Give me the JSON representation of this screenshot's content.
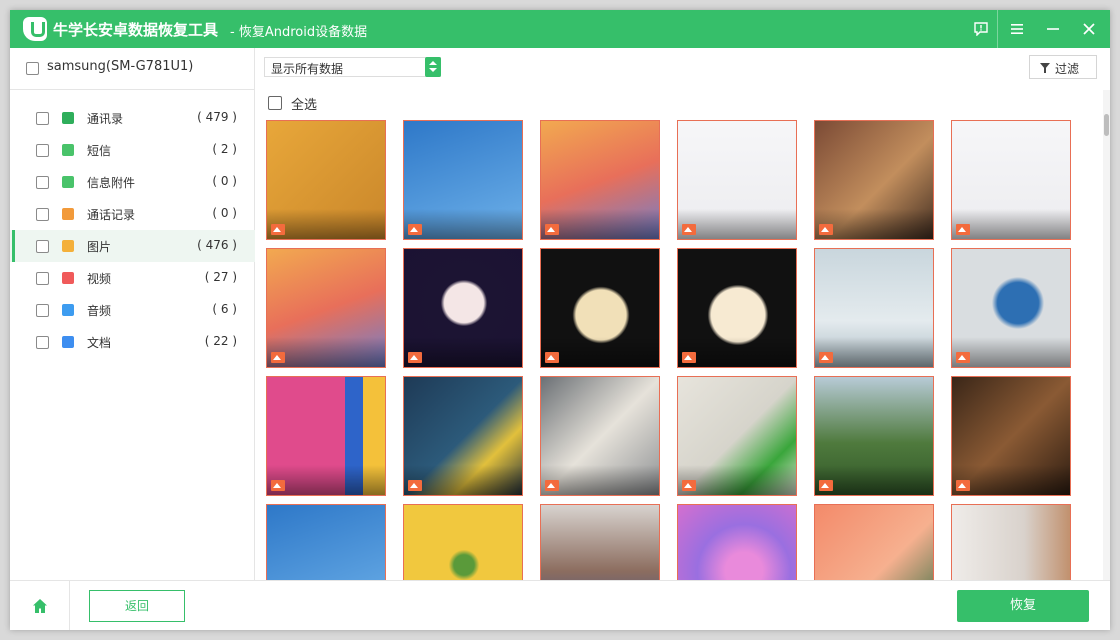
{
  "app": {
    "title": "牛学长安卓数据恢复工具",
    "subtitle": "- 恢复Android设备数据",
    "brand_color": "#36bf6a"
  },
  "titlebar_buttons": [
    {
      "name": "feedback-icon"
    },
    {
      "name": "menu-icon"
    },
    {
      "name": "minimize-icon"
    },
    {
      "name": "close-icon"
    }
  ],
  "device": {
    "name": "samsung(SM-G781U1)"
  },
  "categories": [
    {
      "label": "通讯录",
      "count": "( 479 )",
      "icon": "contacts-icon",
      "color": "#2fae5b"
    },
    {
      "label": "短信",
      "count": "( 2 )",
      "icon": "message-icon",
      "color": "#49c36a"
    },
    {
      "label": "信息附件",
      "count": "( 0 )",
      "icon": "attachment-icon",
      "color": "#49c36a"
    },
    {
      "label": "通话记录",
      "count": "( 0 )",
      "icon": "call-log-icon",
      "color": "#f29a3a"
    },
    {
      "label": "图片",
      "count": "( 476 )",
      "icon": "photo-icon",
      "color": "#f4b03a",
      "active": true
    },
    {
      "label": "视频",
      "count": "( 27 )",
      "icon": "video-icon",
      "color": "#f05a5a"
    },
    {
      "label": "音频",
      "count": "( 6 )",
      "icon": "audio-icon",
      "color": "#3d9cf0"
    },
    {
      "label": "文档",
      "count": "( 22 )",
      "icon": "document-icon",
      "color": "#3d8ef0"
    }
  ],
  "filter_select": {
    "value": "显示所有数据"
  },
  "filter_button": {
    "label": "过滤"
  },
  "select_all": {
    "label": "全选"
  },
  "thumbnails": [
    {
      "name": "thumb-dog-yellow",
      "bg": "linear-gradient(135deg,#e8a73a,#c9862a)"
    },
    {
      "name": "thumb-giraffe-blue",
      "bg": "linear-gradient(160deg,#2e78c8,#6fb2ea)"
    },
    {
      "name": "thumb-ios-homescreen",
      "bg": "linear-gradient(160deg,#f2a950,#e86f5a 50%,#6b7fd0)"
    },
    {
      "name": "thumb-notas-1",
      "bg": "linear-gradient(#f6f6f8,#ececef)"
    },
    {
      "name": "thumb-alpacas",
      "bg": "linear-gradient(135deg,#7b4a35,#c28e5d 55%,#3d2a1f)"
    },
    {
      "name": "thumb-notas-2",
      "bg": "linear-gradient(#f6f6f8,#ececef)"
    },
    {
      "name": "thumb-ios-homescreen-2",
      "bg": "linear-gradient(160deg,#f2a950,#e86f5a 50%,#6b7fd0)"
    },
    {
      "name": "thumb-coffee-laptop",
      "bg": "radial-gradient(circle at 50% 45%,#f4e6e6 22%,#1c1433 26%,#1b1233)"
    },
    {
      "name": "thumb-coffee-dizzy",
      "bg": "radial-gradient(circle at 50% 55%,#f1e0b8 28%,#111 32%)"
    },
    {
      "name": "thumb-coffee-smile",
      "bg": "radial-gradient(circle at 50% 55%,#f7ead2 30%,#111 34%)"
    },
    {
      "name": "thumb-desk-imac",
      "bg": "linear-gradient(#c9d6dd,#e4ebee 60%,#a8b9c2)"
    },
    {
      "name": "thumb-blue-cloth",
      "bg": "radial-gradient(circle at 55% 45%,#2d6fb3 22%,#d9dde0 28%)"
    },
    {
      "name": "thumb-pink-yellow",
      "bg": "linear-gradient(90deg,#e04b8c 65%,#2e64c9 65%,#2e64c9 80%,#f4c13a 80%)"
    },
    {
      "name": "thumb-banana-costumes",
      "bg": "linear-gradient(135deg,#1e3a56,#2c5a7a 50%,#e2c03c 70%,#1c2c3c)"
    },
    {
      "name": "thumb-writing-notebook",
      "bg": "linear-gradient(135deg,#6b7075,#e6e2da 50%,#8c8f92)"
    },
    {
      "name": "thumb-green-drink",
      "bg": "linear-gradient(135deg,#e7e4dc,#d6d4cb 50%,#3aa63b 75%,#e7e4dc)"
    },
    {
      "name": "thumb-hiker-valley",
      "bg": "linear-gradient(#b8cbd7,#4f7a3d 55%,#2f5527)"
    },
    {
      "name": "thumb-guitar",
      "bg": "linear-gradient(135deg,#3a2618,#8a5a34 50%,#2a1a10)"
    },
    {
      "name": "thumb-giraffe-blue-2",
      "bg": "linear-gradient(160deg,#2e78c8,#6fb2ea)"
    },
    {
      "name": "thumb-salad-yellow",
      "bg": "radial-gradient(circle at 50% 50%,#5a9a3a 12%,#f1c83e 18%)"
    },
    {
      "name": "thumb-basketball-court",
      "bg": "linear-gradient(#d8d3cf,#8c6d5f 55%,#3a4f8a)"
    },
    {
      "name": "thumb-purple-bubbles",
      "bg": "radial-gradient(circle at 55% 55%,#e98adb 20%,#9a6fe0 50%,#d46fcf)"
    },
    {
      "name": "thumb-coral-plant",
      "bg": "linear-gradient(135deg,#f38a6a,#f6b08f 55%,#2f6a3f)"
    },
    {
      "name": "thumb-wooden-figure",
      "bg": "linear-gradient(90deg,#efece9,#d9d2cc 60%,#c08e6a)"
    }
  ],
  "footer": {
    "back_label": "返回",
    "recover_label": "恢复"
  }
}
